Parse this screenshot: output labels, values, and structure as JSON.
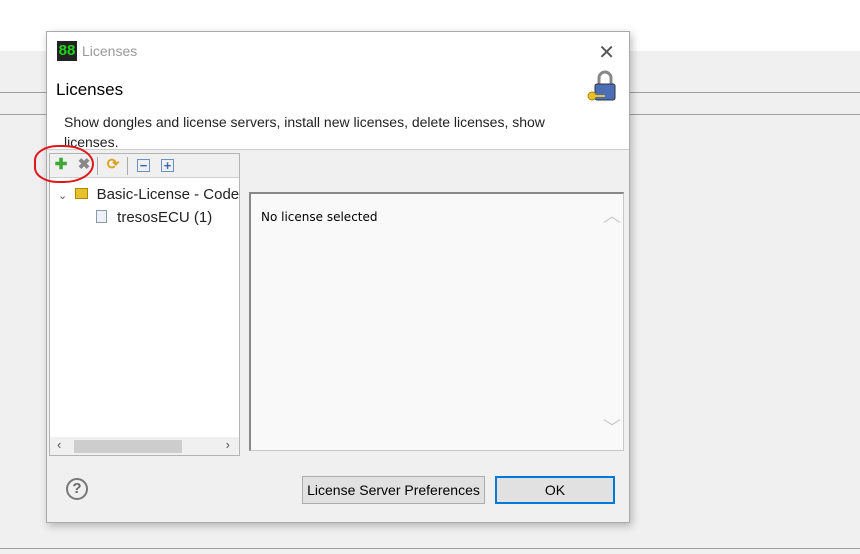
{
  "window": {
    "title": "Licenses",
    "close_icon": "close-icon"
  },
  "header": {
    "title": "Licenses",
    "description": "Show dongles and license servers, install new licenses, delete licenses, show licenses."
  },
  "toolbar": {
    "add": "add-icon",
    "delete": "delete-icon",
    "refresh": "refresh-icon",
    "collapse": "collapse-all-icon",
    "expand": "expand-all-icon"
  },
  "tree": {
    "items": [
      {
        "label": "Basic-License - Code"
      },
      {
        "label": "tresosECU (1)"
      }
    ]
  },
  "details": {
    "text": "No license selected"
  },
  "buttons": {
    "preferences": "License Server Preferences",
    "ok": "OK",
    "help": "?"
  },
  "colors": {
    "accent": "#0078d7",
    "annotation": "#e0161b"
  }
}
